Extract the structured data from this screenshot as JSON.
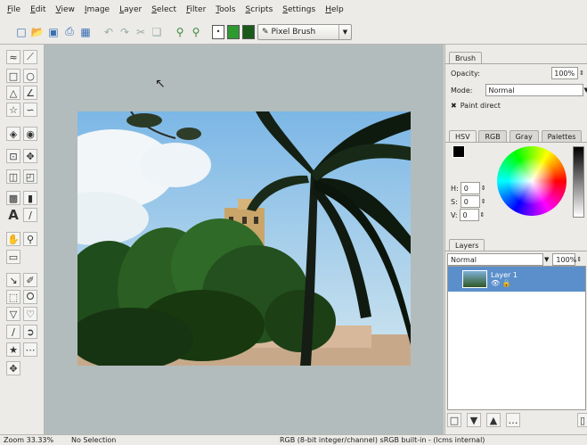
{
  "menu": [
    "File",
    "Edit",
    "View",
    "Image",
    "Layer",
    "Select",
    "Filter",
    "Tools",
    "Scripts",
    "Settings",
    "Help"
  ],
  "toolbar": {
    "brush_preset": "Pixel Brush",
    "fg_color": "#2f9a2f",
    "bg_color": "#1a5a1a",
    "icons": [
      "new-document-icon",
      "open-icon",
      "save-icon",
      "print-icon",
      "scan-icon",
      "undo-icon",
      "redo-icon",
      "cut-icon",
      "copy-icon",
      "zoom-in-icon",
      "zoom-out-icon"
    ]
  },
  "tool_options": {
    "tab": "Brush",
    "opacity_label": "Opacity:",
    "opacity_value": "100%",
    "mode_label": "Mode:",
    "mode_value": "Normal",
    "paint_direct_label": "Paint direct"
  },
  "color_panel": {
    "tabs": [
      "HSV",
      "RGB",
      "Gray",
      "Palettes"
    ],
    "h_label": "H:",
    "h_value": "0",
    "s_label": "S:",
    "s_value": "0",
    "v_label": "V:",
    "v_value": "0"
  },
  "layers_panel": {
    "tab": "Layers",
    "mode": "Normal",
    "opacity": "100%",
    "layer_name": "Layer 1"
  },
  "status": {
    "zoom": "Zoom 33.33%",
    "selection": "No Selection",
    "colorspace": "RGB (8-bit integer/channel)  sRGB built-in - (lcms internal)"
  }
}
